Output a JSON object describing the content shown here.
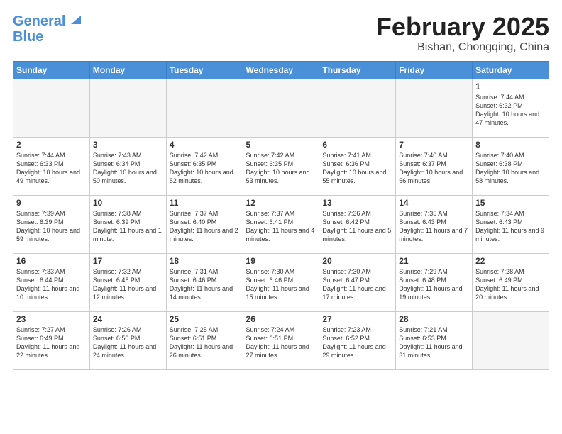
{
  "header": {
    "logo_line1": "General",
    "logo_line2": "Blue",
    "month_title": "February 2025",
    "location": "Bishan, Chongqing, China"
  },
  "weekdays": [
    "Sunday",
    "Monday",
    "Tuesday",
    "Wednesday",
    "Thursday",
    "Friday",
    "Saturday"
  ],
  "weeks": [
    [
      {
        "day": "",
        "info": ""
      },
      {
        "day": "",
        "info": ""
      },
      {
        "day": "",
        "info": ""
      },
      {
        "day": "",
        "info": ""
      },
      {
        "day": "",
        "info": ""
      },
      {
        "day": "",
        "info": ""
      },
      {
        "day": "1",
        "info": "Sunrise: 7:44 AM\nSunset: 6:32 PM\nDaylight: 10 hours and 47 minutes."
      }
    ],
    [
      {
        "day": "2",
        "info": "Sunrise: 7:44 AM\nSunset: 6:33 PM\nDaylight: 10 hours and 49 minutes."
      },
      {
        "day": "3",
        "info": "Sunrise: 7:43 AM\nSunset: 6:34 PM\nDaylight: 10 hours and 50 minutes."
      },
      {
        "day": "4",
        "info": "Sunrise: 7:42 AM\nSunset: 6:35 PM\nDaylight: 10 hours and 52 minutes."
      },
      {
        "day": "5",
        "info": "Sunrise: 7:42 AM\nSunset: 6:35 PM\nDaylight: 10 hours and 53 minutes."
      },
      {
        "day": "6",
        "info": "Sunrise: 7:41 AM\nSunset: 6:36 PM\nDaylight: 10 hours and 55 minutes."
      },
      {
        "day": "7",
        "info": "Sunrise: 7:40 AM\nSunset: 6:37 PM\nDaylight: 10 hours and 56 minutes."
      },
      {
        "day": "8",
        "info": "Sunrise: 7:40 AM\nSunset: 6:38 PM\nDaylight: 10 hours and 58 minutes."
      }
    ],
    [
      {
        "day": "9",
        "info": "Sunrise: 7:39 AM\nSunset: 6:39 PM\nDaylight: 10 hours and 59 minutes."
      },
      {
        "day": "10",
        "info": "Sunrise: 7:38 AM\nSunset: 6:39 PM\nDaylight: 11 hours and 1 minute."
      },
      {
        "day": "11",
        "info": "Sunrise: 7:37 AM\nSunset: 6:40 PM\nDaylight: 11 hours and 2 minutes."
      },
      {
        "day": "12",
        "info": "Sunrise: 7:37 AM\nSunset: 6:41 PM\nDaylight: 11 hours and 4 minutes."
      },
      {
        "day": "13",
        "info": "Sunrise: 7:36 AM\nSunset: 6:42 PM\nDaylight: 11 hours and 5 minutes."
      },
      {
        "day": "14",
        "info": "Sunrise: 7:35 AM\nSunset: 6:43 PM\nDaylight: 11 hours and 7 minutes."
      },
      {
        "day": "15",
        "info": "Sunrise: 7:34 AM\nSunset: 6:43 PM\nDaylight: 11 hours and 9 minutes."
      }
    ],
    [
      {
        "day": "16",
        "info": "Sunrise: 7:33 AM\nSunset: 6:44 PM\nDaylight: 11 hours and 10 minutes."
      },
      {
        "day": "17",
        "info": "Sunrise: 7:32 AM\nSunset: 6:45 PM\nDaylight: 11 hours and 12 minutes."
      },
      {
        "day": "18",
        "info": "Sunrise: 7:31 AM\nSunset: 6:46 PM\nDaylight: 11 hours and 14 minutes."
      },
      {
        "day": "19",
        "info": "Sunrise: 7:30 AM\nSunset: 6:46 PM\nDaylight: 11 hours and 15 minutes."
      },
      {
        "day": "20",
        "info": "Sunrise: 7:30 AM\nSunset: 6:47 PM\nDaylight: 11 hours and 17 minutes."
      },
      {
        "day": "21",
        "info": "Sunrise: 7:29 AM\nSunset: 6:48 PM\nDaylight: 11 hours and 19 minutes."
      },
      {
        "day": "22",
        "info": "Sunrise: 7:28 AM\nSunset: 6:49 PM\nDaylight: 11 hours and 20 minutes."
      }
    ],
    [
      {
        "day": "23",
        "info": "Sunrise: 7:27 AM\nSunset: 6:49 PM\nDaylight: 11 hours and 22 minutes."
      },
      {
        "day": "24",
        "info": "Sunrise: 7:26 AM\nSunset: 6:50 PM\nDaylight: 11 hours and 24 minutes."
      },
      {
        "day": "25",
        "info": "Sunrise: 7:25 AM\nSunset: 6:51 PM\nDaylight: 11 hours and 26 minutes."
      },
      {
        "day": "26",
        "info": "Sunrise: 7:24 AM\nSunset: 6:51 PM\nDaylight: 11 hours and 27 minutes."
      },
      {
        "day": "27",
        "info": "Sunrise: 7:23 AM\nSunset: 6:52 PM\nDaylight: 11 hours and 29 minutes."
      },
      {
        "day": "28",
        "info": "Sunrise: 7:21 AM\nSunset: 6:53 PM\nDaylight: 11 hours and 31 minutes."
      },
      {
        "day": "",
        "info": ""
      }
    ]
  ]
}
